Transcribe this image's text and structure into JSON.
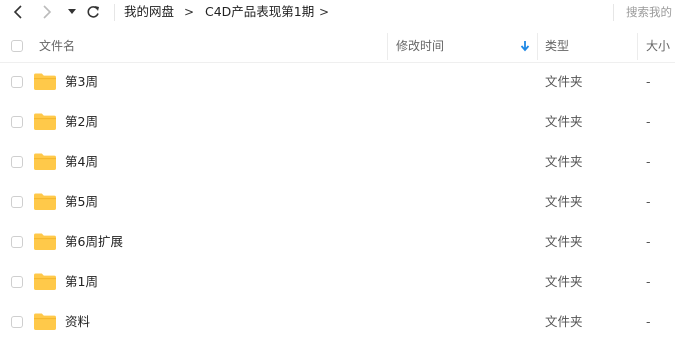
{
  "breadcrumb": {
    "items": [
      "我的网盘",
      "C4D产品表现第1期"
    ],
    "separator": ">"
  },
  "search": {
    "placeholder": "搜索我的"
  },
  "columns": {
    "name": "文件名",
    "modified": "修改时间",
    "type": "类型",
    "size": "大小"
  },
  "rows": [
    {
      "name": "第3周",
      "type": "文件夹",
      "size": "-"
    },
    {
      "name": "第2周",
      "type": "文件夹",
      "size": "-"
    },
    {
      "name": "第4周",
      "type": "文件夹",
      "size": "-"
    },
    {
      "name": "第5周",
      "type": "文件夹",
      "size": "-"
    },
    {
      "name": "第6周扩展",
      "type": "文件夹",
      "size": "-"
    },
    {
      "name": "第1周",
      "type": "文件夹",
      "size": "-"
    },
    {
      "name": "资料",
      "type": "文件夹",
      "size": "-"
    }
  ],
  "colors": {
    "folder": "#FFC94A",
    "sort_arrow": "#1E88E5"
  }
}
